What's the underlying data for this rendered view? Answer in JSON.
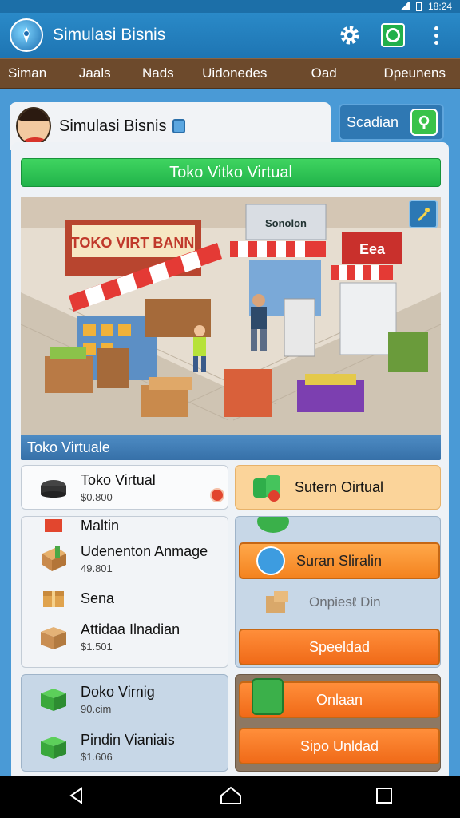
{
  "status_bar": {
    "time": "18:24"
  },
  "app_bar": {
    "title": "Simulasi Bisnis",
    "icons": [
      "app-logo-icon",
      "settings-icon",
      "store-icon",
      "more-icon"
    ]
  },
  "nav": {
    "tabs": [
      "Siman",
      "Jaals",
      "Nads",
      "Uidonedes",
      "Oad",
      "Dpeunens"
    ]
  },
  "profile": {
    "name": "Simulasi Bisnis"
  },
  "scan_button": {
    "label": "Scadian"
  },
  "banner": {
    "label": "Toko Vitko Virtual"
  },
  "scene": {
    "caption": "Toko Virtuale",
    "signs": {
      "left": "TOKO VIRT BANN",
      "middle": "Sonolon",
      "right": "Eea"
    }
  },
  "left_column": {
    "top_item": {
      "title": "Toko Virtual",
      "subtitle": "$0.800"
    },
    "section_label": "Maltin",
    "items": [
      {
        "title": "Udenenton Anmage",
        "subtitle": "49.801"
      },
      {
        "title": "Sena",
        "subtitle": ""
      },
      {
        "title": "Attidaa Ilnadian",
        "subtitle": "$1.501"
      }
    ],
    "bottom_items": [
      {
        "title": "Doko Virnig",
        "subtitle": "90.cim"
      },
      {
        "title": "Pindin Vianiais",
        "subtitle": "$1.606"
      }
    ]
  },
  "right_column": {
    "top_item": {
      "label": "Sutern Oirtual"
    },
    "buttons": [
      {
        "label": "Suran Sliralin"
      },
      {
        "label": "Onpiesℓ Din"
      },
      {
        "label": "Speeldad"
      },
      {
        "label": "Onlaan"
      },
      {
        "label": "Sipo Unldad"
      }
    ]
  },
  "system_nav": {
    "icons": [
      "back-icon",
      "home-icon",
      "recents-icon"
    ]
  },
  "colors": {
    "appbar": "#1e75b3",
    "nav": "#6d4a2c",
    "banner": "#21b34a",
    "orange": "#f4831f",
    "panel_blue": "#c7d7e7"
  }
}
